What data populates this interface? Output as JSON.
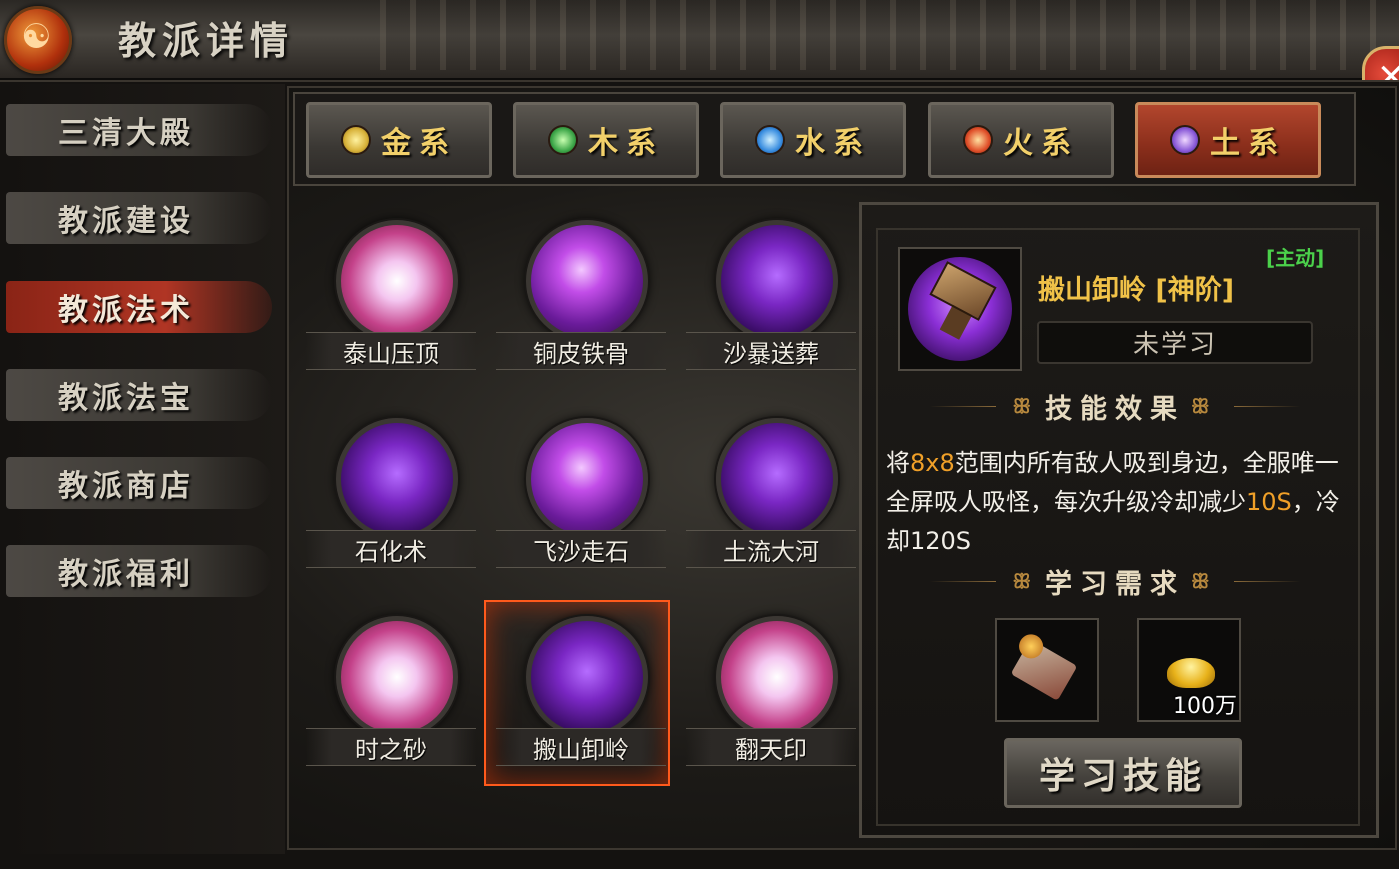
{
  "header": {
    "title": "教派详情"
  },
  "sidebar": {
    "items": [
      {
        "label": "三清大殿"
      },
      {
        "label": "教派建设"
      },
      {
        "label": "教派法术",
        "active": true
      },
      {
        "label": "教派法宝"
      },
      {
        "label": "教派商店"
      },
      {
        "label": "教派福利"
      }
    ]
  },
  "tabs": [
    {
      "label": "金系",
      "icon": "gold-element-icon",
      "color": "#d8b23a"
    },
    {
      "label": "木系",
      "icon": "wood-element-icon",
      "color": "#3fa84a"
    },
    {
      "label": "水系",
      "icon": "water-element-icon",
      "color": "#3a8ee0"
    },
    {
      "label": "火系",
      "icon": "fire-element-icon",
      "color": "#e0502a"
    },
    {
      "label": "土系",
      "icon": "earth-element-icon",
      "color": "#8a5ad8",
      "active": true
    }
  ],
  "skills": [
    {
      "name": "泰山压顶"
    },
    {
      "name": "铜皮铁骨"
    },
    {
      "name": "沙暴送葬"
    },
    {
      "name": "石化术"
    },
    {
      "name": "飞沙走石"
    },
    {
      "name": "土流大河"
    },
    {
      "name": "时之砂"
    },
    {
      "name": "搬山卸岭",
      "selected": true
    },
    {
      "name": "翻天印"
    }
  ],
  "detail": {
    "tag": "[主动]",
    "title": "搬山卸岭 [神阶]",
    "status": "未学习",
    "effect_heading": "技能效果",
    "description": {
      "part1": "将",
      "highlight1": "8x8",
      "part2": "范围内所有敌人吸到身边，全服唯一全屏吸人吸怪，每次升级冷却减少",
      "highlight2": "10S",
      "part3": "，冷却120S"
    },
    "requirement_heading": "学习需求",
    "requirements": [
      {
        "icon": "skill-book-icon",
        "qty": ""
      },
      {
        "icon": "gold-ingot-icon",
        "qty": "100万"
      }
    ],
    "learn_button": "学习技能"
  },
  "colors": {
    "accent": "#f0c248",
    "active_tag": "#4bd14b",
    "selection": "#ff5a1c"
  }
}
